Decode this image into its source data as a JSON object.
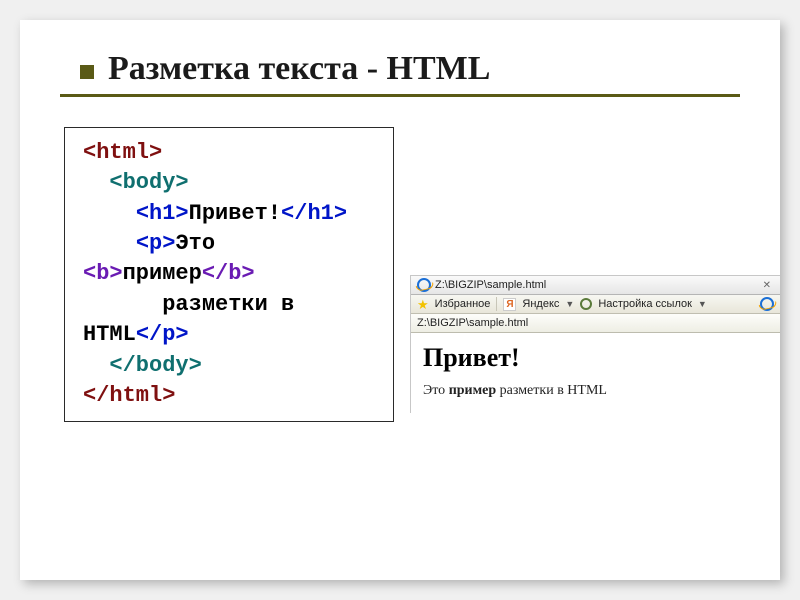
{
  "title": "Разметка текста - HTML",
  "code": {
    "html_open": "<html>",
    "body_open": "<body>",
    "h1_open": "<h1>",
    "h1_text": "Привет!",
    "h1_close": "</h1>",
    "p_open": "<p>",
    "p_text1": "Это ",
    "b_open": "<b>",
    "b_text": "пример",
    "b_close": "</b>",
    "p_text2_line1": "      разметки в",
    "p_text2_line2": "HTML",
    "p_close": "</p>",
    "body_close": "</body>",
    "html_close": "</html>"
  },
  "browser": {
    "tab_label": "Z:\\BIGZIP\\sample.html",
    "fav_label": "Избранное",
    "yandex_label": "Яндекс",
    "settings_label": "Настройка ссылок",
    "address": "Z:\\BIGZIP\\sample.html",
    "page_h1": "Привет!",
    "page_text_before": "Это ",
    "page_text_bold": "пример",
    "page_text_after": " разметки в HTML"
  }
}
